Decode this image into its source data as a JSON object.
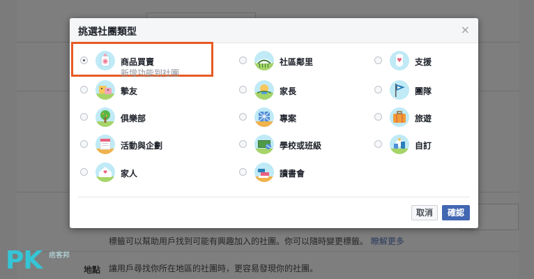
{
  "background": {
    "hint_text": "標籤可以幫助用戶找到可能有興趣加入的社團。你可以隨時變更標籤。",
    "learn_more": "瞭解更多",
    "location_label": "地點",
    "location_hint": "讓用戶尋找你所在地區的社團時，更容易發現你的社團。",
    "watermark_logo": "PK",
    "watermark_sub": "痞客邦"
  },
  "dialog": {
    "title": "挑選社團類型",
    "close_glyph": "×",
    "cancel_label": "取消",
    "confirm_label": "確認",
    "options": [
      {
        "label": "商品買賣",
        "sub": "新增功能到社團",
        "icon": "shopping-bag-icon",
        "selected": true
      },
      {
        "label": "社區鄰里",
        "icon": "neighborhood-icon",
        "selected": false
      },
      {
        "label": "支援",
        "icon": "support-hands-icon",
        "selected": false
      },
      {
        "label": "摯友",
        "icon": "close-friends-icon",
        "selected": false
      },
      {
        "label": "家長",
        "icon": "parents-icon",
        "selected": false
      },
      {
        "label": "團隊",
        "icon": "team-flag-icon",
        "selected": false
      },
      {
        "label": "俱樂部",
        "icon": "club-tree-icon",
        "selected": false
      },
      {
        "label": "專案",
        "icon": "project-icon",
        "selected": false
      },
      {
        "label": "旅遊",
        "icon": "travel-suitcase-icon",
        "selected": false
      },
      {
        "label": "活動與企劃",
        "icon": "event-calendar-icon",
        "selected": false
      },
      {
        "label": "學校或班級",
        "icon": "school-icon",
        "selected": false
      },
      {
        "label": "自訂",
        "icon": "custom-icon",
        "selected": false
      },
      {
        "label": "家人",
        "icon": "family-home-icon",
        "selected": false
      },
      {
        "label": "讀書會",
        "icon": "book-club-icon",
        "selected": false
      }
    ]
  },
  "colors": {
    "accent": "#4267b2",
    "highlight_border": "#e85a23",
    "icon_bg": "#bfeaf6"
  }
}
